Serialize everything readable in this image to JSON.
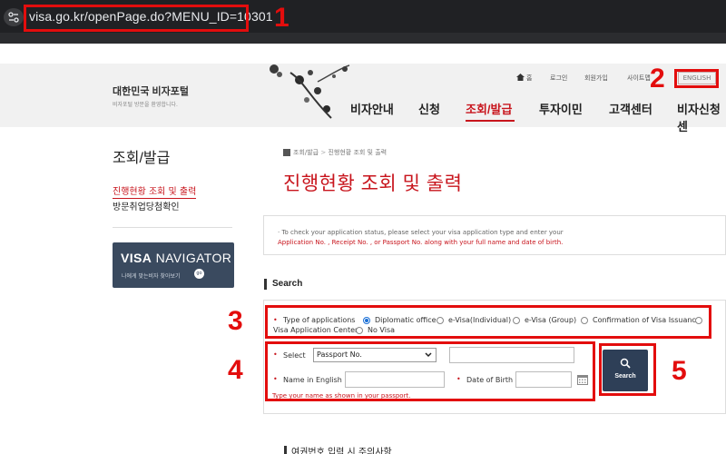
{
  "browser": {
    "url": "visa.go.kr/openPage.do?MENU_ID=10301"
  },
  "header": {
    "logo_title": "대한민국 비자포털",
    "logo_subtitle": "비자포털 방문을 환영합니다.",
    "utility": [
      "홈",
      "로그인",
      "회원가입",
      "사이트맵"
    ],
    "english": "ENGLISH",
    "gnb": [
      "비자안내",
      "신청",
      "조회/발급",
      "투자이민",
      "고객센터",
      "비자신청센"
    ]
  },
  "lnb": {
    "title": "조회/발급",
    "items": [
      "진행현황 조회 및 출력",
      "방문취업당첨확인"
    ],
    "visa_navigator": {
      "title_bold": "VISA",
      "title_rest": "NAVIGATOR",
      "subtitle": "나에게 맞는비자 찾아보기",
      "go": "go"
    }
  },
  "content": {
    "breadcrumb": [
      "조회/발급",
      "진행현황 조회 및 출력"
    ],
    "title": "진행현황 조회 및 출력",
    "notice_line1": "· To check your application status, please select your visa application type and enter your",
    "notice_line2": "Application No. , Receipt No. , or Passport No. along with your full name and date of birth.",
    "search_section": "Search",
    "form": {
      "type_label": "Type of applications",
      "types": [
        "Diplomatic office",
        "e-Visa(Individual)",
        "e-Visa (Group)",
        "Confirmation of Visa Issuance",
        "Visa Application Center",
        "No Visa"
      ],
      "selected_type": "Diplomatic office",
      "select_label": "Select",
      "select_value": "Passport No.",
      "name_label": "Name in English",
      "dob_label": "Date of Birth",
      "hint": "Type your name as shown in your passport.",
      "search_button": "Search"
    },
    "next_section": "여권번호 입력 시 주의사항"
  },
  "annotations": [
    "1",
    "2",
    "3",
    "4",
    "5"
  ],
  "colors": {
    "accent": "#c8151d",
    "annotation": "#e30d0d",
    "navy": "#2e3f57"
  }
}
